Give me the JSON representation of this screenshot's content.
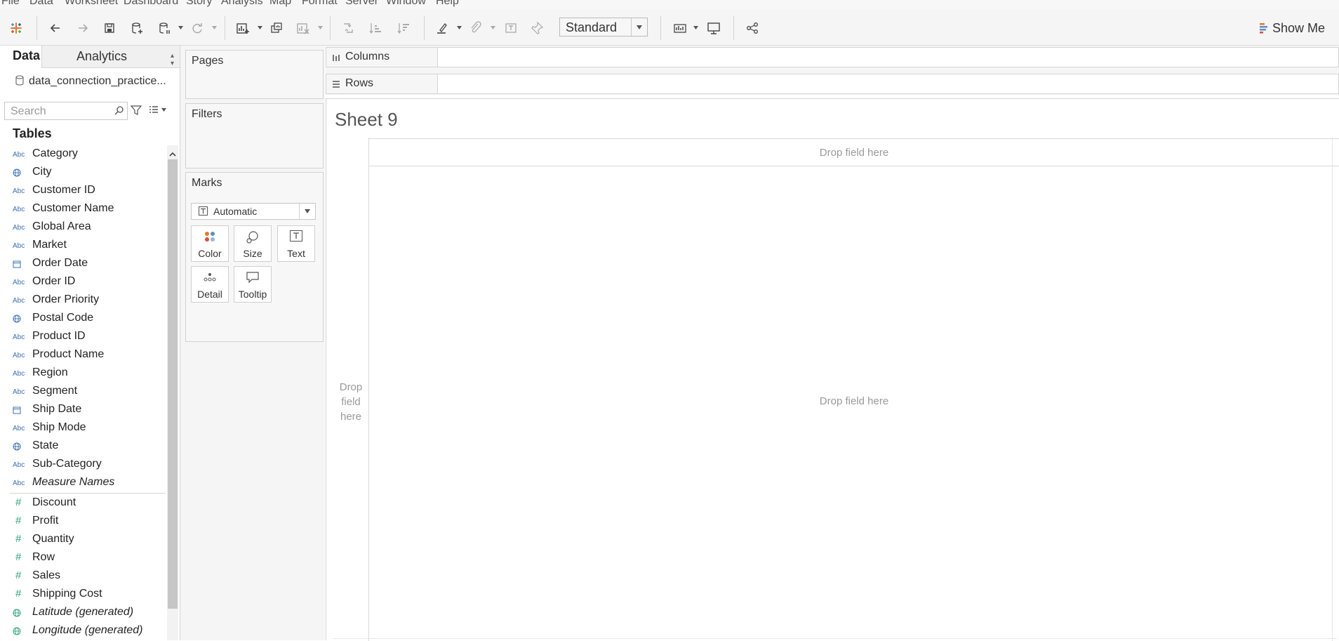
{
  "menu": [
    "File",
    "Data",
    "Worksheet",
    "Dashboard",
    "Story",
    "Analysis",
    "Map",
    "Format",
    "Server",
    "Window",
    "Help"
  ],
  "toolbar": {
    "fit_value": "Standard",
    "show_me_label": "Show Me"
  },
  "data_pane": {
    "tab_data": "Data",
    "tab_analytics": "Analytics",
    "datasource_name": "data_connection_practice...",
    "search_placeholder": "Search",
    "tables_heading": "Tables",
    "fields": [
      {
        "label": "Category",
        "type": "abc"
      },
      {
        "label": "City",
        "type": "geo"
      },
      {
        "label": "Customer ID",
        "type": "abc"
      },
      {
        "label": "Customer Name",
        "type": "abc"
      },
      {
        "label": "Global Area",
        "type": "abc"
      },
      {
        "label": "Market",
        "type": "abc"
      },
      {
        "label": "Order Date",
        "type": "date"
      },
      {
        "label": "Order ID",
        "type": "abc"
      },
      {
        "label": "Order Priority",
        "type": "abc"
      },
      {
        "label": "Postal Code",
        "type": "geo"
      },
      {
        "label": "Product ID",
        "type": "abc"
      },
      {
        "label": "Product Name",
        "type": "abc"
      },
      {
        "label": "Region",
        "type": "abc"
      },
      {
        "label": "Segment",
        "type": "abc"
      },
      {
        "label": "Ship Date",
        "type": "date"
      },
      {
        "label": "Ship Mode",
        "type": "abc"
      },
      {
        "label": "State",
        "type": "geo"
      },
      {
        "label": "Sub-Category",
        "type": "abc"
      },
      {
        "label": "Measure Names",
        "type": "abc",
        "italic": true
      },
      {
        "label": "Discount",
        "type": "measure"
      },
      {
        "label": "Profit",
        "type": "measure"
      },
      {
        "label": "Quantity",
        "type": "measure"
      },
      {
        "label": "Row",
        "type": "measure"
      },
      {
        "label": "Sales",
        "type": "measure"
      },
      {
        "label": "Shipping Cost",
        "type": "measure"
      },
      {
        "label": "Latitude (generated)",
        "type": "geo",
        "italic": true
      },
      {
        "label": "Longitude (generated)",
        "type": "geo",
        "italic": true
      }
    ],
    "abc_glyph": "Abc",
    "measure_glyph": "#"
  },
  "cards": {
    "pages_title": "Pages",
    "filters_title": "Filters",
    "marks_title": "Marks",
    "mark_type": "Automatic",
    "mark_buttons": {
      "color": "Color",
      "size": "Size",
      "text": "Text",
      "detail": "Detail",
      "tooltip": "Tooltip"
    }
  },
  "shelves": {
    "columns_label": "Columns",
    "rows_label": "Rows"
  },
  "canvas": {
    "sheet_title": "Sheet 9",
    "drop_columns": "Drop field here",
    "drop_rows": "Drop field here",
    "drop_body": "Drop field here"
  },
  "colors": {
    "dimension_blue": "#3a6fb0",
    "measure_green": "#2ea37a",
    "tableau_orange": "#e8762c"
  }
}
